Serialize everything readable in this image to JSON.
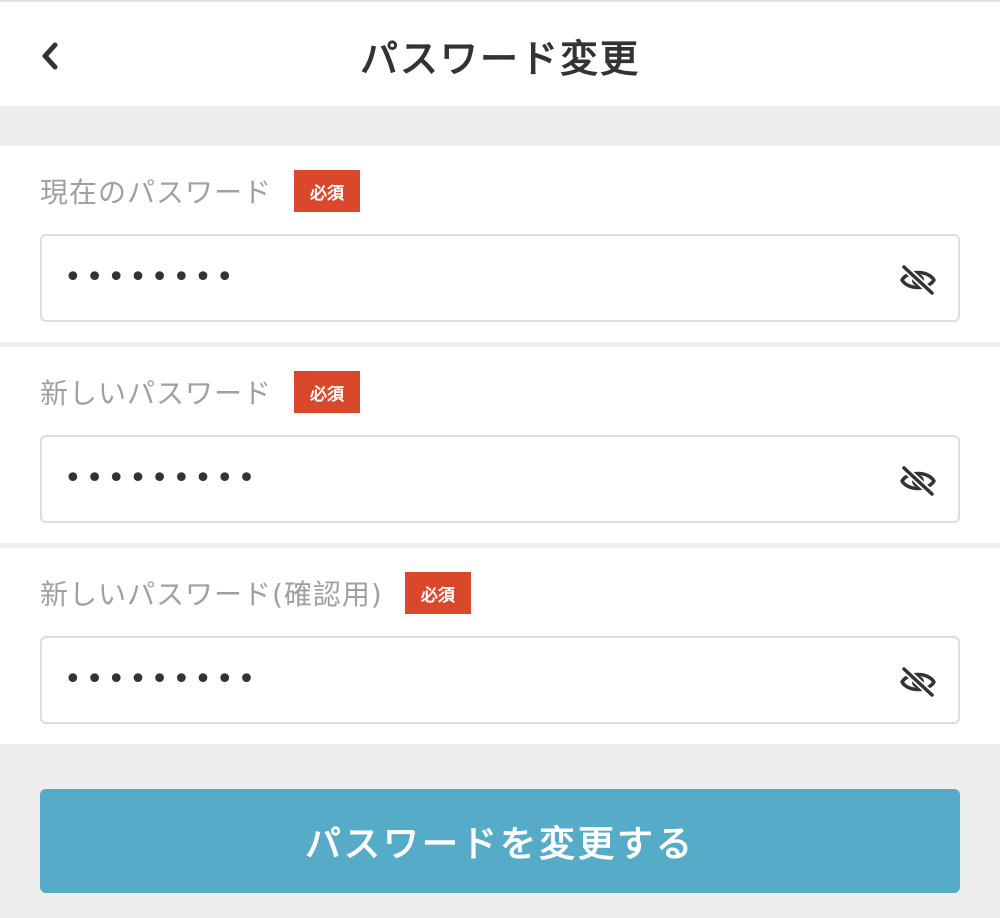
{
  "header": {
    "title": "パスワード変更",
    "back_icon": "chevron-left-icon"
  },
  "fields": [
    {
      "label": "現在のパスワード",
      "required_badge": "必須",
      "value": "••••••••",
      "visibility_icon": "eye-slash-icon"
    },
    {
      "label": "新しいパスワード",
      "required_badge": "必須",
      "value": "•••••••••",
      "visibility_icon": "eye-slash-icon"
    },
    {
      "label": "新しいパスワード(確認用)",
      "required_badge": "必須",
      "value": "•••••••••",
      "visibility_icon": "eye-slash-icon"
    }
  ],
  "submit_button": {
    "label": "パスワードを変更する"
  },
  "colors": {
    "accent": "#56abc8",
    "required_badge": "#d9482b",
    "page_background": "#eeeeee",
    "label_text": "#a0a0a0"
  }
}
